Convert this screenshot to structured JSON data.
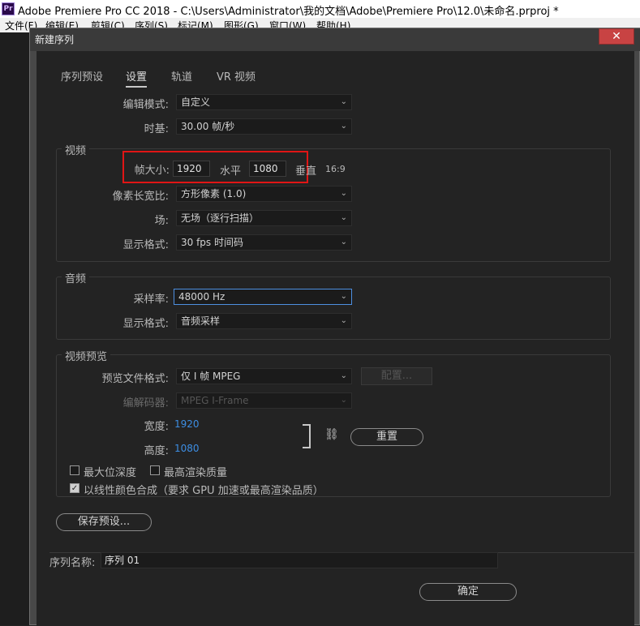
{
  "app_title": "Adobe Premiere Pro CC 2018 - C:\\Users\\Administrator\\我的文档\\Adobe\\Premiere Pro\\12.0\\未命名.prproj *",
  "app_icon": "Pr",
  "menu": [
    "文件(F)",
    "编辑(E)",
    "剪辑(C)",
    "序列(S)",
    "标记(M)",
    "图形(G)",
    "窗口(W)",
    "帮助(H)"
  ],
  "dialog": {
    "title": "新建序列",
    "close_glyph": "✕",
    "tabs": [
      "序列预设",
      "设置",
      "轨道",
      "VR 视频"
    ],
    "active_tab": "设置",
    "edit_mode": {
      "label": "编辑模式:",
      "value": "自定义"
    },
    "timebase": {
      "label": "时基:",
      "value": "30.00  帧/秒"
    },
    "video": {
      "section": "视频",
      "frame_size_label": "帧大小:",
      "width": "1920",
      "horizontal_label": "水平",
      "height": "1080",
      "vertical_label": "垂直",
      "aspect": "16:9",
      "pixel_aspect": {
        "label": "像素长宽比:",
        "value": "方形像素 (1.0)"
      },
      "fields": {
        "label": "场:",
        "value": "无场（逐行扫描）"
      },
      "display_format": {
        "label": "显示格式:",
        "value": "30 fps 时间码"
      }
    },
    "audio": {
      "section": "音频",
      "sample_rate": {
        "label": "采样率:",
        "value": "48000 Hz"
      },
      "display_format": {
        "label": "显示格式:",
        "value": "音频采样"
      }
    },
    "preview": {
      "section": "视频预览",
      "file_format": {
        "label": "预览文件格式:",
        "value": "仅 I 帧 MPEG"
      },
      "configure": "配置...",
      "codec": {
        "label": "编解码器:",
        "value": "MPEG I-Frame"
      },
      "width": {
        "label": "宽度:",
        "value": "1920"
      },
      "height": {
        "label": "高度:",
        "value": "1080"
      },
      "reset": "重置",
      "max_bit_depth": "最大位深度",
      "max_render_quality": "最高渲染质量",
      "linear_color": "以线性颜色合成（要求 GPU 加速或最高渲染品质）"
    },
    "save_preset": "保存预设...",
    "sequence_name": {
      "label": "序列名称:",
      "value": "序列 01"
    },
    "ok": "确定"
  },
  "colors": {
    "accent_blue": "#3d8ee3",
    "highlight_red": "#e01515",
    "close_red": "#c84343"
  }
}
